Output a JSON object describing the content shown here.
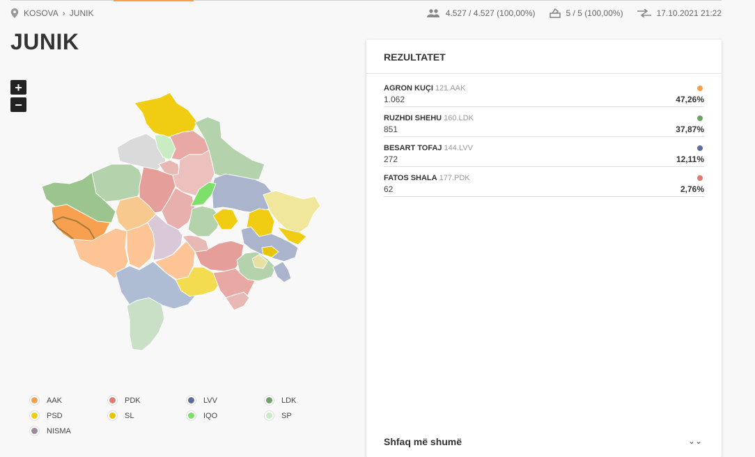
{
  "breadcrumb": {
    "root": "KOSOVA",
    "current": "JUNIK"
  },
  "stats": {
    "voters": "4.527 / 4.527 (100,00%)",
    "stations": "5 / 5 (100,00%)",
    "updated": "17.10.2021 21:22"
  },
  "page_title": "JUNIK",
  "zoom": {
    "in": "+",
    "out": "−"
  },
  "panel": {
    "title": "REZULTATET",
    "results": [
      {
        "name": "AGRON KUÇI",
        "code": "121.AAK",
        "votes": "1.062",
        "pct": "47,26%",
        "color": "#f6a04d"
      },
      {
        "name": "RUZHDI SHEHU",
        "code": "160.LDK",
        "votes": "851",
        "pct": "37,87%",
        "color": "#6fa267"
      },
      {
        "name": "BESART TOFAJ",
        "code": "144.LVV",
        "votes": "272",
        "pct": "12,11%",
        "color": "#5c6d9c"
      },
      {
        "name": "FATOS SHALA",
        "code": "177.PDK",
        "votes": "62",
        "pct": "2,76%",
        "color": "#e07a70"
      }
    ],
    "more_label": "Shfaq më shumë"
  },
  "legend": [
    {
      "label": "AAK",
      "color": "#f6a04d"
    },
    {
      "label": "PDK",
      "color": "#e07a70"
    },
    {
      "label": "LVV",
      "color": "#5c6d9c"
    },
    {
      "label": "LDK",
      "color": "#6fa267"
    },
    {
      "label": "PSD",
      "color": "#f0cc13"
    },
    {
      "label": "SL",
      "color": "#e7c500"
    },
    {
      "label": "IQO",
      "color": "#7ee06b"
    },
    {
      "label": "SP",
      "color": "#c9ecc3"
    },
    {
      "label": "NISMA",
      "color": "#9c879e"
    }
  ]
}
